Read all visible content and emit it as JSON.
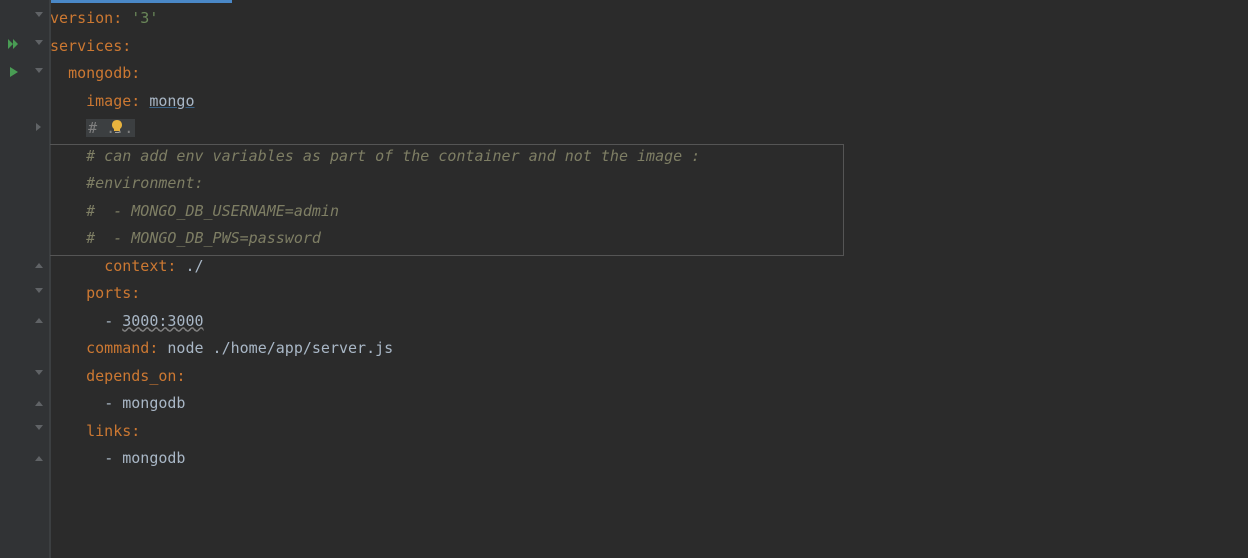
{
  "lines": {
    "l1_key": "version",
    "l1_val": "'3'",
    "l2_key": "services",
    "l3_key": "mongodb",
    "l4_key": "image",
    "l4_val": "mongo",
    "l5_comment": "# ...",
    "l6_comment": "# can add env variables as part of the container and not the image :",
    "l7_comment": "#environment:",
    "l8_comment": "#  - MONGO_DB_USERNAME=admin",
    "l9_comment": "#  - MONGO_DB_PWS=password",
    "l10_key": "context",
    "l10_val": "./",
    "l11_key": "ports",
    "l12_val": "3000:3000",
    "l13_key": "command",
    "l13_val": "node ./home/app/server.js",
    "l14_key": "depends_on",
    "l15_val": "mongodb",
    "l16_key": "links",
    "l17_val": "mongodb"
  },
  "icons": {
    "play_double": "run-services",
    "play_single": "run-service",
    "bulb": "suggestion-bulb"
  }
}
